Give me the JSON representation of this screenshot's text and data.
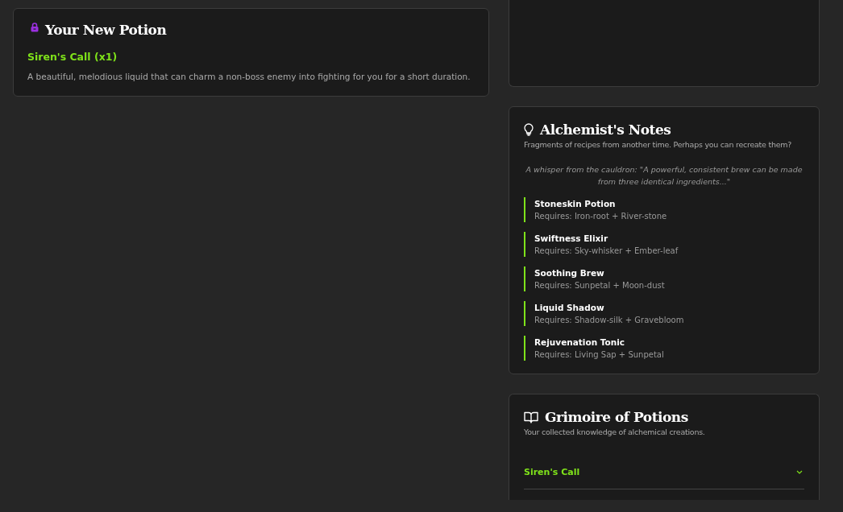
{
  "new_potion": {
    "title": "Your New Potion",
    "name": "Siren's Call (x1)",
    "description": "A beautiful, melodious liquid that can charm a non-boss enemy into fighting for you for a short duration."
  },
  "notes": {
    "title": "Alchemist's Notes",
    "subtitle": "Fragments of recipes from another time. Perhaps you can recreate them?",
    "whisper": "A whisper from the cauldron: \"A powerful, consistent brew can be made from three identical ingredients...\"",
    "recipes": [
      {
        "name": "Stoneskin Potion",
        "requires": "Requires: Iron-root + River-stone"
      },
      {
        "name": "Swiftness Elixir",
        "requires": "Requires: Sky-whisker + Ember-leaf"
      },
      {
        "name": "Soothing Brew",
        "requires": "Requires: Sunpetal + Moon-dust"
      },
      {
        "name": "Liquid Shadow",
        "requires": "Requires: Shadow-silk + Gravebloom"
      },
      {
        "name": "Rejuvenation Tonic",
        "requires": "Requires: Living Sap + Sunpetal"
      }
    ]
  },
  "grimoire": {
    "title": "Grimoire of Potions",
    "subtitle": "Your collected knowledge of alchemical creations.",
    "items": [
      {
        "name": "Siren's Call",
        "expanded": false
      }
    ]
  }
}
